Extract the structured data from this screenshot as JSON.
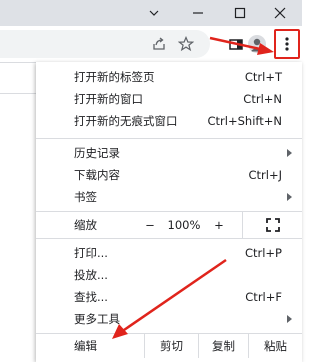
{
  "window": {
    "controls": [
      "minimize",
      "maximize",
      "close"
    ]
  },
  "toolbar": {
    "icons": [
      "share-icon",
      "bookmark-star-icon",
      "side-panel-icon",
      "profile-avatar-icon",
      "more-menu-icon"
    ]
  },
  "menu": {
    "group1": [
      {
        "label": "打开新的标签页",
        "shortcut": "Ctrl+T"
      },
      {
        "label": "打开新的窗口",
        "shortcut": "Ctrl+N"
      },
      {
        "label": "打开新的无痕式窗口",
        "shortcut": "Ctrl+Shift+N"
      }
    ],
    "group2": [
      {
        "label": "历史记录",
        "submenu": true
      },
      {
        "label": "下载内容",
        "shortcut": "Ctrl+J"
      },
      {
        "label": "书签",
        "submenu": true
      }
    ],
    "zoom": {
      "label": "缩放",
      "minus": "−",
      "value": "100%",
      "plus": "+"
    },
    "group3": [
      {
        "label": "打印...",
        "shortcut": "Ctrl+P"
      },
      {
        "label": "投放..."
      },
      {
        "label": "查找...",
        "shortcut": "Ctrl+F"
      },
      {
        "label": "更多工具",
        "submenu": true
      }
    ],
    "edit": {
      "label": "编辑",
      "cut": "剪切",
      "copy": "复制",
      "paste": "粘贴"
    }
  },
  "colors": {
    "annotation": "#e0241c",
    "titlebar": "#dee1e6",
    "icon": "#5f6368"
  }
}
